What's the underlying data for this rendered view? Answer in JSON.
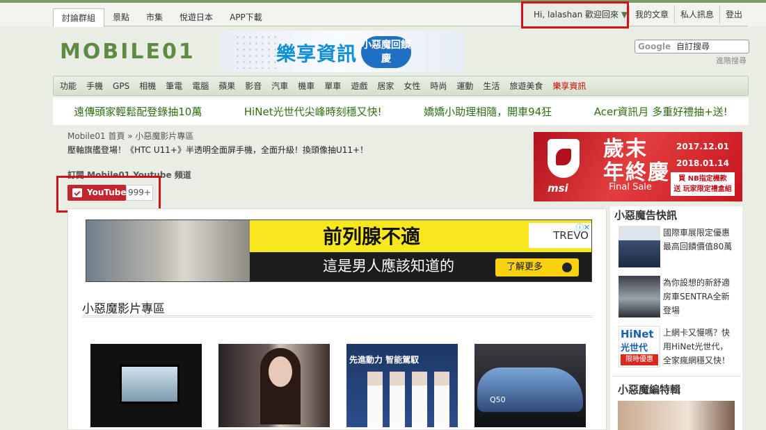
{
  "top_nav": {
    "tabs": [
      "討論群組",
      "景點",
      "市集",
      "悅遊日本",
      "APP下載"
    ],
    "active_index": 0,
    "user_greeting": "Hi, lalashan 歡迎回來",
    "dropdown_arrow": "▼",
    "my_posts": "我的文章",
    "private_messages": "私人訊息",
    "logout": "登出"
  },
  "header": {
    "logo_text": "MOBILE01",
    "banner_main": "樂享資訊",
    "banner_sub": "小惡魔回饋慶",
    "search_brand": "Google",
    "search_placeholder": "自訂搜尋",
    "advanced_search": "進階搜尋"
  },
  "categories": [
    "功能",
    "手機",
    "GPS",
    "相機",
    "筆電",
    "電腦",
    "蘋果",
    "影音",
    "汽車",
    "機車",
    "單車",
    "遊戲",
    "居家",
    "女性",
    "時尚",
    "運動",
    "生活",
    "旅遊美食",
    "樂享資訊"
  ],
  "ticker": [
    "遠傳頭家輕鬆配登錄抽10萬",
    "HiNet光世代尖峰時刻穩又快!",
    "嬌嬌小助理相隨，開車94狂",
    "Acer資訊月 多重好禮抽+送!"
  ],
  "breadcrumb": "Mobile01 首頁 » 小惡魔影片專區",
  "intro": "壓軸旗艦登場！《HTC U11+》半透明全面屏手機，全面升級！換頭像抽U11+！",
  "subscribe_label": "訂閱 Mobile01 Youtube 頻道",
  "youtube": {
    "label": "YouTube",
    "count": "999+"
  },
  "msi_ad": {
    "brand": "msi",
    "title_line1": "歲末",
    "title_line2": "年終慶",
    "subtitle": "Final Sale",
    "date_start": "2017.12.01",
    "date_end": "2018.01.14",
    "promo_line1": "買 NB指定機款",
    "promo_line2": "送 玩家限定禮盒組"
  },
  "main_ad": {
    "headline": "前列腺不適",
    "subline": "這是男人應該知道的",
    "cta": "了解更多",
    "brand": "TREVO"
  },
  "section_title": "小惡魔影片專區",
  "thumbnails": {
    "t3_text": "先進動力 智能駕馭",
    "t4_label": "Q50"
  },
  "sidebar": {
    "news_title": "小惡魔告快訊",
    "items": [
      {
        "text": "國際車展限定優惠最高回饋價值80萬"
      },
      {
        "text": "為你設想的新舒適房車SENTRA全新登場"
      },
      {
        "text": "上網卡又慢嗎？快用HiNet光世代，全家瘋網穩又快！"
      }
    ],
    "hinet_logo": "HiNet",
    "hinet_sub": "光世代",
    "hinet_badge": "限時優惠",
    "feature_title": "小惡魔編特輯"
  },
  "colors": {
    "accent_green": "#7e9b6a",
    "highlight_red": "#d0101a",
    "youtube_red": "#c4262e",
    "link_green": "#2d6e10"
  }
}
